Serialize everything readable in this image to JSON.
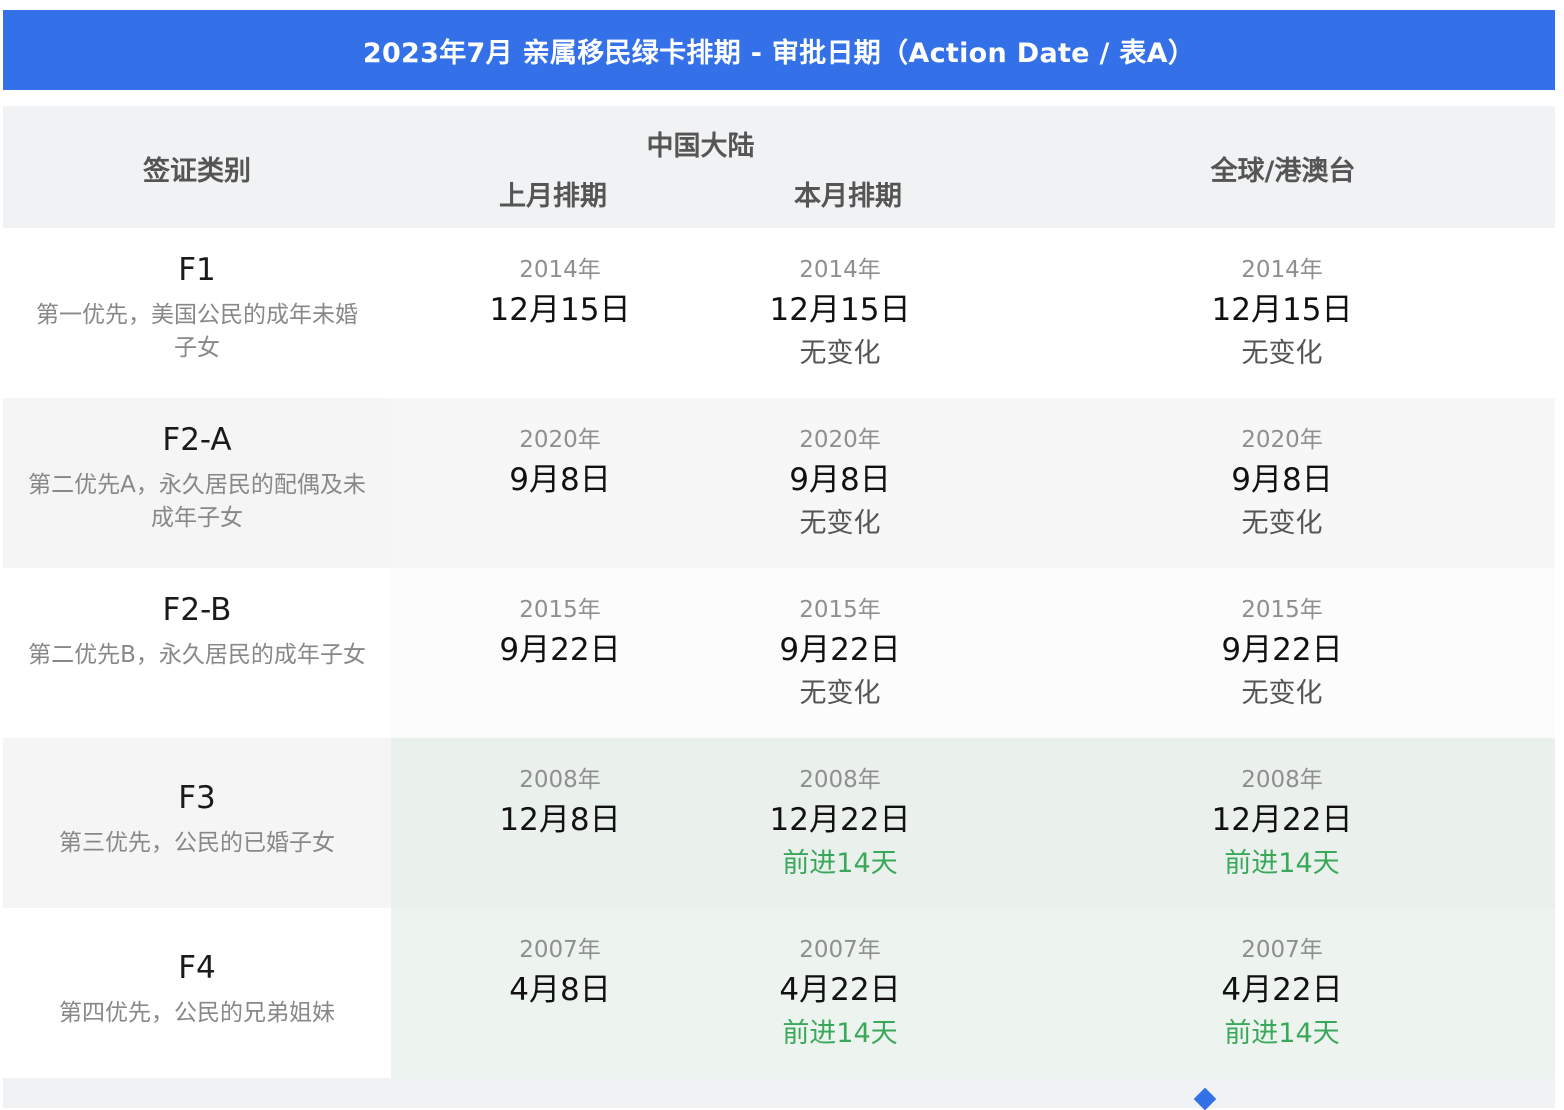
{
  "title": "2023年7月 亲属移民绿卡排期 - 审批日期（Action Date / 表A）",
  "header": {
    "category": "签证类别",
    "china": "中国大陆",
    "prev_month": "上月排期",
    "this_month": "本月排期",
    "global": "全球/港澳台"
  },
  "rows": [
    {
      "code": "F1",
      "desc": "第一优先，美国公民的成年未婚子女",
      "cn_prev": {
        "year": "2014年",
        "date": "12月15日"
      },
      "cn_curr": {
        "year": "2014年",
        "date": "12月15日",
        "status": "无变化"
      },
      "global": {
        "year": "2014年",
        "date": "12月15日",
        "status": "无变化"
      }
    },
    {
      "code": "F2-A",
      "desc": "第二优先A，永久居民的配偶及未成年子女",
      "cn_prev": {
        "year": "2020年",
        "date": "9月8日"
      },
      "cn_curr": {
        "year": "2020年",
        "date": "9月8日",
        "status": "无变化"
      },
      "global": {
        "year": "2020年",
        "date": "9月8日",
        "status": "无变化"
      }
    },
    {
      "code": "F2-B",
      "desc": "第二优先B，永久居民的成年子女",
      "cn_prev": {
        "year": "2015年",
        "date": "9月22日"
      },
      "cn_curr": {
        "year": "2015年",
        "date": "9月22日",
        "status": "无变化"
      },
      "global": {
        "year": "2015年",
        "date": "9月22日",
        "status": "无变化"
      }
    },
    {
      "code": "F3",
      "desc": "第三优先，公民的已婚子女",
      "cn_prev": {
        "year": "2008年",
        "date": "12月8日"
      },
      "cn_curr": {
        "year": "2008年",
        "date": "12月22日",
        "status": "前进14天"
      },
      "global": {
        "year": "2008年",
        "date": "12月22日",
        "status": "前进14天"
      }
    },
    {
      "code": "F4",
      "desc": "第四优先，公民的兄弟姐妹",
      "cn_prev": {
        "year": "2007年",
        "date": "4月8日"
      },
      "cn_curr": {
        "year": "2007年",
        "date": "4月22日",
        "status": "前进14天"
      },
      "global": {
        "year": "2007年",
        "date": "4月22日",
        "status": "前进14天"
      }
    }
  ],
  "colors": {
    "title_bg": "#3471e8",
    "header_bg": "#f1f2f4",
    "advance_text": "#3aa85a",
    "advanced_row_bg": "#eaf0ec"
  }
}
